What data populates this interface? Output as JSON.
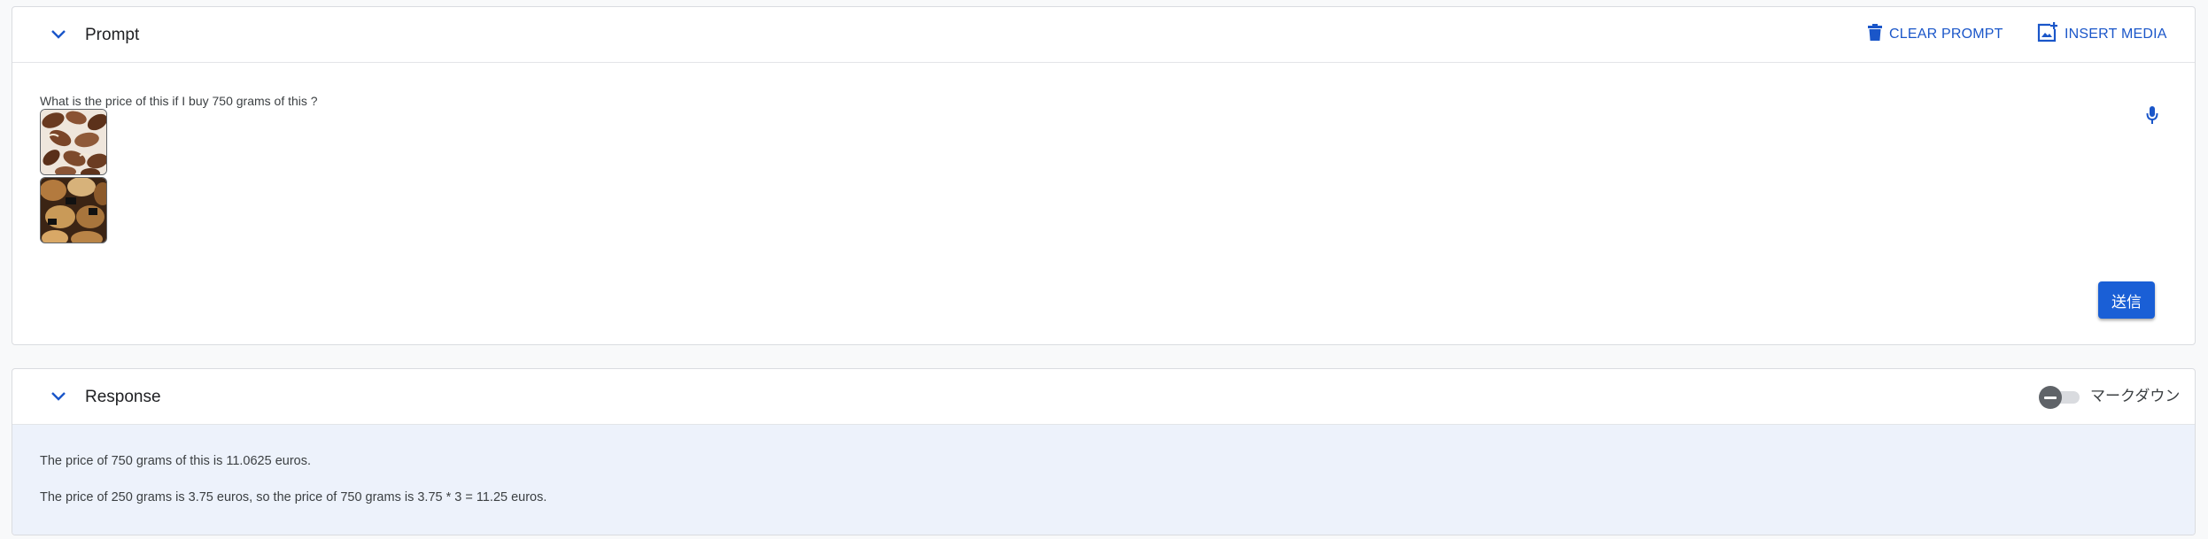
{
  "prompt": {
    "title": "Prompt",
    "clear_label": "CLEAR PROMPT",
    "insert_media_label": "INSERT MEDIA",
    "text": "What is the price of this if I buy 750 grams of this ?",
    "send_label": "送信"
  },
  "response": {
    "title": "Response",
    "markdown_label": "マークダウン",
    "markdown_enabled": false,
    "lines": [
      "The price of 750 grams of this is 11.0625 euros.",
      "The price of 250 grams is 3.75 euros, so the price of 750 grams is 3.75 * 3 = 11.25 euros."
    ]
  },
  "icons": {
    "collapse": "chevron-down-icon",
    "clear": "trash-icon",
    "insert_media": "add-photo-icon",
    "mic": "mic-icon"
  },
  "colors": {
    "accent": "#1a56c9",
    "send_button": "#1a5fd6",
    "response_background": "#edf2fb"
  }
}
